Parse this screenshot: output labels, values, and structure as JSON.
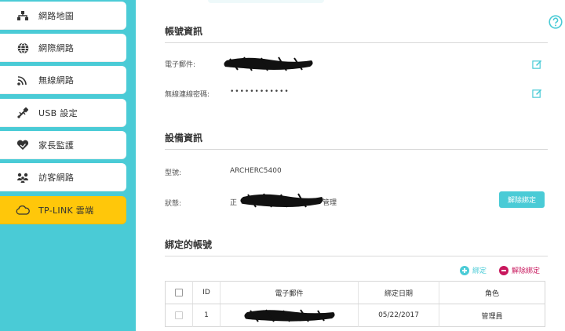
{
  "sidebar": {
    "items": [
      {
        "label": "網路地圖",
        "icon": "network-map-icon"
      },
      {
        "label": "網際網路",
        "icon": "globe-icon"
      },
      {
        "label": "無線網路",
        "icon": "wifi-icon"
      },
      {
        "label": "USB 設定",
        "icon": "usb-icon"
      },
      {
        "label": "家長監護",
        "icon": "heart-icon"
      },
      {
        "label": "訪客網路",
        "icon": "guest-users-icon"
      },
      {
        "label": "TP-LINK 雲端",
        "icon": "cloud-icon"
      }
    ],
    "active_index": 6
  },
  "account_info": {
    "title": "帳號資訊",
    "email_label": "電子郵件:",
    "password_label": "無線連線密碼:",
    "password_value": "••••••••••••"
  },
  "device_info": {
    "title": "設備資訊",
    "model_label": "型號:",
    "model_value": "ARCHERC5400",
    "status_label": "狀態:",
    "status_prefix": "正",
    "status_suffix": "管理",
    "unbind_label": "解除綁定"
  },
  "bound_accounts": {
    "title": "綁定的帳號",
    "add_label": "綁定",
    "remove_label": "解除綁定",
    "columns": [
      "ID",
      "電子郵件",
      "綁定日期",
      "角色"
    ],
    "rows": [
      {
        "id": "1",
        "date": "05/22/2017",
        "role": "管理員"
      }
    ]
  },
  "colors": {
    "sidebar_bg": "#4acbd6",
    "active_item": "#ffc70a",
    "accent": "#4acbd6",
    "danger": "#c8175d"
  }
}
